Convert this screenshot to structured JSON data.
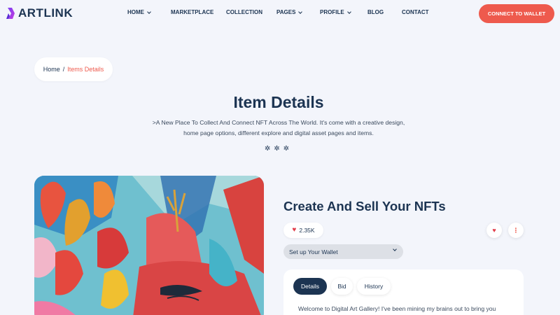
{
  "brand": {
    "name": "ARTLINK"
  },
  "nav": [
    {
      "label": "HOME",
      "has_dropdown": true
    },
    {
      "label": "MARKETPLACE",
      "has_dropdown": false
    },
    {
      "label": "COLLECTION",
      "has_dropdown": false
    },
    {
      "label": "PAGES",
      "has_dropdown": true
    },
    {
      "label": "PROFILE",
      "has_dropdown": true
    },
    {
      "label": "BLOG",
      "has_dropdown": false
    },
    {
      "label": "CONTACT",
      "has_dropdown": false
    }
  ],
  "header": {
    "connect_label": "CONNECT TO WALLET"
  },
  "breadcrumb": {
    "home": "Home",
    "separator": "/",
    "current": "Items Details"
  },
  "hero": {
    "title": "Item Details",
    "subtitle_line1": ">A New Place To Collect And Connect NFT Across The World. It's come with a creative design,",
    "subtitle_line2": "home page options, different explore and digital asset pages and items."
  },
  "item": {
    "title": "Create And Sell Your NFTs",
    "likes": "2.35K",
    "wallet_select": "Set up Your Wallet",
    "tabs": [
      "Details",
      "Bid",
      "History"
    ],
    "active_tab": "Details",
    "description": "Welcome to Digital Art Gallery! I've been mining my brains out to bring you"
  },
  "colors": {
    "accent": "#ee5a4d",
    "navy": "#1c3452",
    "background": "#f3f5fb",
    "heart": "#e23d4a"
  },
  "icons": [
    "logo-icon",
    "chevron-down-icon",
    "gear-icon",
    "heart-icon",
    "more-vertical-icon"
  ]
}
